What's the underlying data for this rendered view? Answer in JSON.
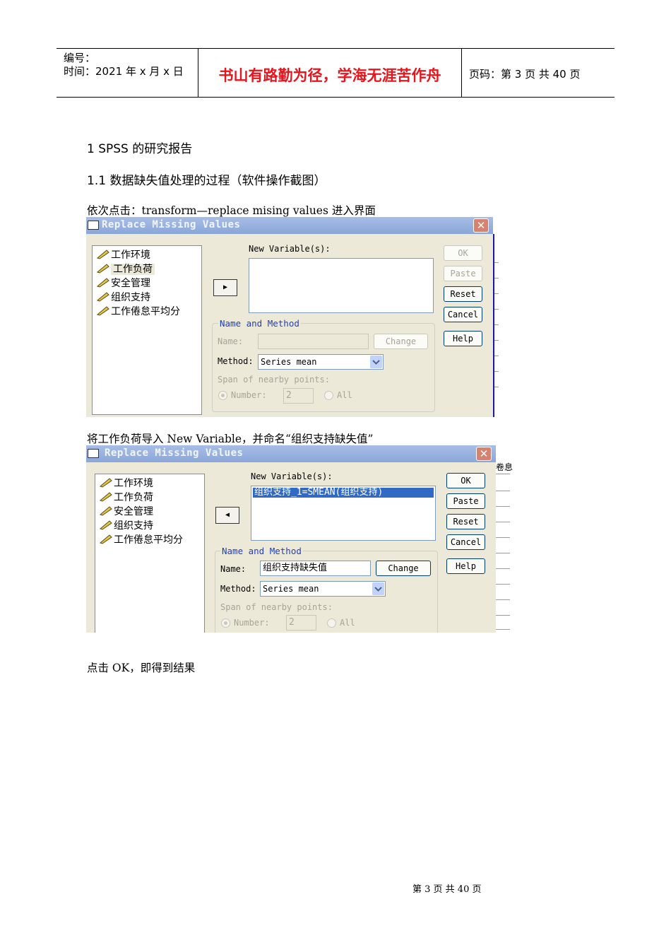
{
  "header": {
    "number_label": "编号：",
    "time_label": "时间：2021 年 x 月 x 日",
    "motto": "书山有路勤为径，学海无涯苦作舟",
    "page_label": "页码：第 3 页  共 40 页"
  },
  "section1_title": "1 SPSS 的研究报告",
  "section11_title": "1.1  数据缺失值处理的过程（软件操作截图）",
  "para1": "依次点击：transform—replace mising values 进入界面",
  "para2": "将工作负荷导入 New Variable，并命名“组织支持缺失值”",
  "para3": "点击 OK，即得到结果",
  "footer": "第  3  页  共  40  页",
  "dialog1": {
    "title": "Replace Missing Values",
    "variables": [
      "工作环境",
      "工作负荷",
      "安全管理",
      "组织支持",
      "工作倦怠平均分"
    ],
    "selected_variable": "工作负荷",
    "new_variables_label": "New Variable(s):",
    "new_variables": [],
    "group_label": "Name and Method",
    "name_label": "Name:",
    "name_value": "",
    "change_label": "Change",
    "method_label": "Method:",
    "method_value": "Series mean",
    "span_label": "Span of nearby points:",
    "number_label": "Number:",
    "number_value": "2",
    "all_label": "All",
    "buttons": [
      "OK",
      "Paste",
      "Reset",
      "Cancel",
      "Help"
    ]
  },
  "dialog2": {
    "title": "Replace Missing Values",
    "variables": [
      "工作环境",
      "工作负荷",
      "安全管理",
      "组织支持",
      "工作倦怠平均分"
    ],
    "new_variables_label": "New Variable(s):",
    "new_variables": [
      "组织支持_1=SMEAN(组织支持)"
    ],
    "group_label": "Name and Method",
    "name_label": "Name:",
    "name_value": "组织支持缺失值",
    "change_label": "Change",
    "method_label": "Method:",
    "method_value": "Series mean",
    "span_label": "Span of nearby points:",
    "number_label": "Number:",
    "number_value": "2",
    "all_label": "All",
    "buttons": [
      "OK",
      "Paste",
      "Reset",
      "Cancel",
      "Help"
    ],
    "edge_fragment": "卷息"
  },
  "icons": {
    "variable": "ruler-icon",
    "close": "close-icon",
    "dropdown": "chevron-down-icon"
  },
  "colors": {
    "motto": "#e8141b",
    "group_label": "#1f3fbf",
    "selection": "#316ac5",
    "dialog_bg": "#ece9d8"
  }
}
